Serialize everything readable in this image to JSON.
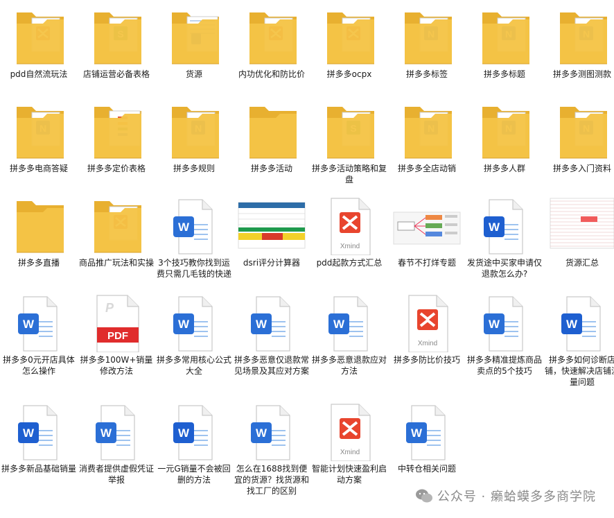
{
  "window": {
    "title": ""
  },
  "items": [
    {
      "label": "pdd自然流玩法",
      "type": "folder",
      "icon": "xmind"
    },
    {
      "label": "店铺运营必备表格",
      "type": "folder",
      "icon": "excel"
    },
    {
      "label": "货源",
      "type": "folder",
      "icon": "sheet"
    },
    {
      "label": "内功优化和防比价",
      "type": "folder",
      "icon": "xmind"
    },
    {
      "label": "拼多多ocpx",
      "type": "folder",
      "icon": "xmind"
    },
    {
      "label": "拼多多标签",
      "type": "folder",
      "icon": "word"
    },
    {
      "label": "拼多多标题",
      "type": "folder",
      "icon": "word"
    },
    {
      "label": "拼多多测图测款",
      "type": "folder",
      "icon": "word"
    },
    {
      "label": "拼多多电商答疑",
      "type": "folder",
      "icon": "word"
    },
    {
      "label": "拼多多定价表格",
      "type": "folder",
      "icon": "mindmap"
    },
    {
      "label": "拼多多规则",
      "type": "folder",
      "icon": "word"
    },
    {
      "label": "拼多多活动",
      "type": "folder",
      "icon": "blank"
    },
    {
      "label": "拼多多活动策略和复盘",
      "type": "folder",
      "icon": "excel"
    },
    {
      "label": "拼多多全店动销",
      "type": "folder",
      "icon": "word"
    },
    {
      "label": "拼多多人群",
      "type": "folder",
      "icon": "word"
    },
    {
      "label": "拼多多入门资料",
      "type": "folder",
      "icon": "word"
    },
    {
      "label": "拼多多直播",
      "type": "folder",
      "icon": "blank"
    },
    {
      "label": "商品推广玩法和实操",
      "type": "folder",
      "icon": "xmind"
    },
    {
      "label": "3个技巧教你找到运费只需几毛钱的快递",
      "type": "word"
    },
    {
      "label": "dsri评分计算器",
      "type": "sheet-thumb"
    },
    {
      "label": "pdd起款方式汇总",
      "type": "xmind",
      "caption": "Xmind"
    },
    {
      "label": "春节不打烊专题",
      "type": "mindmap-thumb"
    },
    {
      "label": "发货途中买家申请仅退款怎么办?",
      "type": "word-blue"
    },
    {
      "label": "货源汇总",
      "type": "table-thumb"
    },
    {
      "label": "拼多多0元开店具体怎么操作",
      "type": "word"
    },
    {
      "label": "拼多多100W+销量修改方法",
      "type": "pdf",
      "caption": "PDF"
    },
    {
      "label": "拼多多常用核心公式大全",
      "type": "word"
    },
    {
      "label": "拼多多恶意仅退款常见场景及其应对方案",
      "type": "word"
    },
    {
      "label": "拼多多恶意退款应对方法",
      "type": "word"
    },
    {
      "label": "拼多多防比价技巧",
      "type": "xmind",
      "caption": "Xmind"
    },
    {
      "label": "拼多多精准提炼商品卖点的5个技巧",
      "type": "word"
    },
    {
      "label": "拼多多如何诊断店铺，快速解决店铺流量问题",
      "type": "word-blue"
    },
    {
      "label": "拼多多新品基础销量",
      "type": "word-blue"
    },
    {
      "label": "消费者提供虚假凭证举报",
      "type": "word"
    },
    {
      "label": "一元G销量不会被回删的方法",
      "type": "word-blue"
    },
    {
      "label": "怎么在1688找到便宜的货源？找货源和找工厂的区别",
      "type": "word"
    },
    {
      "label": "智能计划快速盈利启动方案",
      "type": "xmind",
      "caption": "Xmind"
    },
    {
      "label": "中转仓相关问题",
      "type": "word"
    }
  ],
  "icons": {
    "word_letter": "W"
  },
  "watermark": {
    "text": "公众号 · 癞蛤蟆多多商学院"
  },
  "colors": {
    "folder": "#f5c446",
    "folder_back": "#e8b030",
    "word": "#2b6fd6",
    "xmind": "#e8452e",
    "excel": "#1f9a4d",
    "pdf": "#e02c2c"
  }
}
